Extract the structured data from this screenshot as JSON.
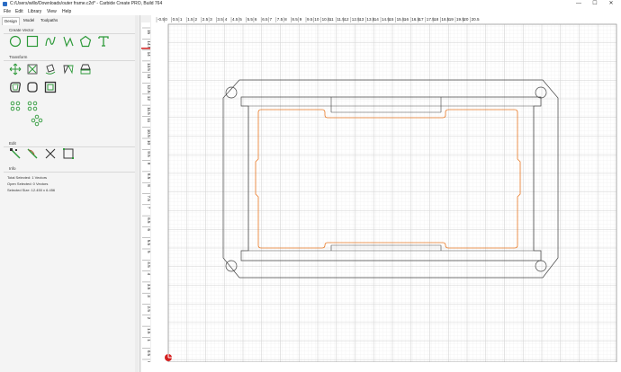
{
  "window": {
    "title": "C:/Users/willo/Downloads/outer frame.c2d* - Carbide Create PRO, Build 764",
    "minimize_glyph": "—",
    "maximize_glyph": "☐",
    "close_glyph": "✕"
  },
  "menu": [
    "File",
    "Edit",
    "Library",
    "View",
    "Help"
  ],
  "tabs": [
    "Design",
    "Model",
    "Toolpaths"
  ],
  "sections": {
    "create_vector": "Create Vector",
    "transform": "Transform",
    "edit": "Edit",
    "info": "Info"
  },
  "icons": {
    "create_vector": [
      "circle-icon",
      "rectangle-icon",
      "curve-icon",
      "polyline-icon",
      "polygon-icon",
      "text-icon"
    ],
    "transform_row1": [
      "move-icon",
      "scale-icon",
      "rotate-icon",
      "mirror-icon",
      "align-icon"
    ],
    "transform_row2": [
      "offset-icon",
      "round-corners-icon",
      "boolean-icon"
    ],
    "transform_row3": [
      "circular-array-icon",
      "grid-array-icon",
      "pattern-icon"
    ],
    "edit": [
      "node-edit-icon",
      "knife-icon",
      "trim-icon",
      "join-icon"
    ]
  },
  "info": {
    "total_selected": "Total Selected: 1 Vectors",
    "open_selected": "Open Selected: 0 Vectors",
    "selected_size": "Selected Size: 12.450 x 6.456"
  },
  "ruler_x": [
    "-0.5",
    "0",
    "0.5",
    "1",
    "1.5",
    "2",
    "2.5",
    "3",
    "3.5",
    "4",
    "4.5",
    "5",
    "5.5",
    "6",
    "6.5",
    "7",
    "7.5",
    "8",
    "8.5",
    "9",
    "9.5",
    "10",
    "10.5",
    "11",
    "11.5",
    "12",
    "12.5",
    "13",
    "13.5",
    "14",
    "14.5",
    "15",
    "15.5",
    "16",
    "16.5",
    "17",
    "17.5",
    "18",
    "18.5",
    "19",
    "19.5",
    "20",
    "20.5"
  ],
  "ruler_y": [
    "15",
    "14.5",
    "14",
    "13.5",
    "13",
    "12.5",
    "12",
    "11.5",
    "11",
    "10.5",
    "10",
    "9.5",
    "9",
    "8.5",
    "8",
    "7.5",
    "7",
    "6.5",
    "6",
    "5.5",
    "5",
    "4.5",
    "4",
    "3.5",
    "3",
    "2.5",
    "2",
    "1.5",
    "1",
    "0.5",
    "0"
  ],
  "colors": {
    "accent_green": "#2e9a3a",
    "selected_vector": "#e87722",
    "vector": "#444444",
    "origin_marker": "#d42020"
  }
}
